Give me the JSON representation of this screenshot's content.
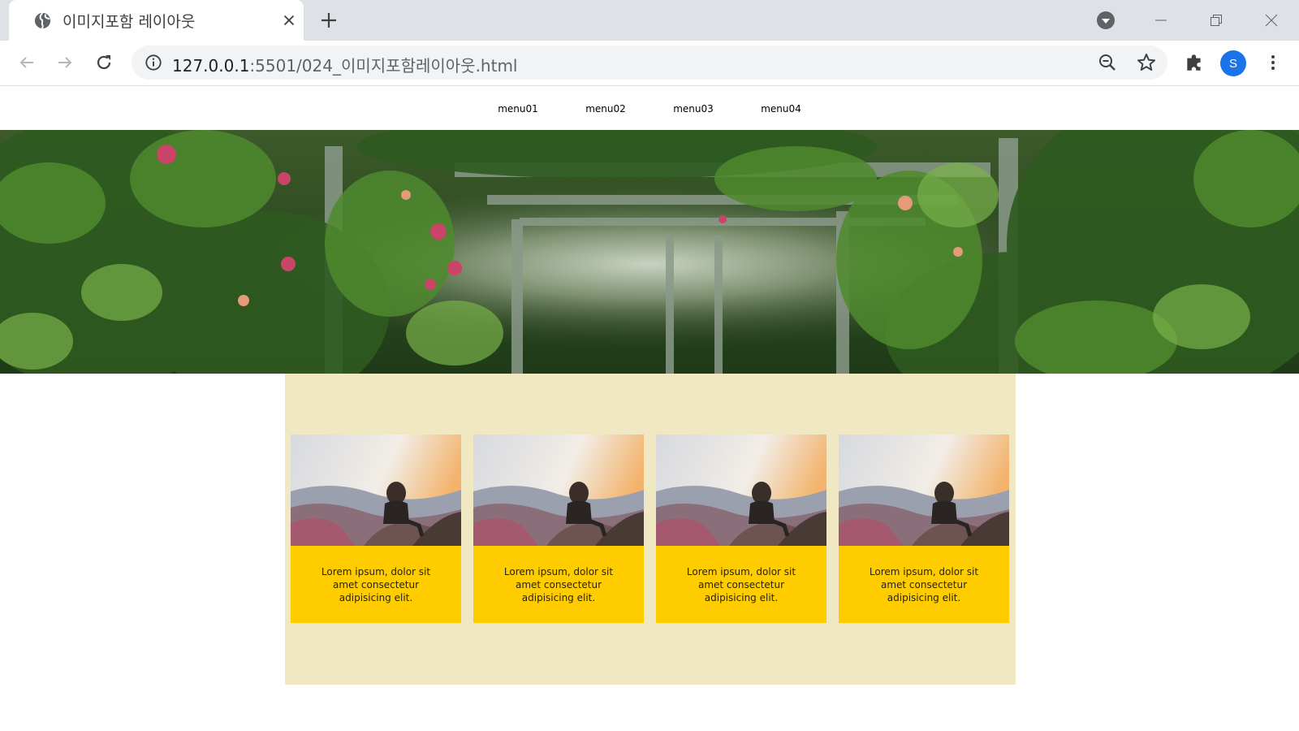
{
  "browser": {
    "tab_title": "이미지포함 레이아웃",
    "url_host": "127.0.0.1",
    "url_path": ":5501/024_이미지포함레이아웃.html",
    "avatar_letter": "S",
    "accent_color": "#1a73e8"
  },
  "icons": {
    "favicon": "globe-icon",
    "tab_close": "close-icon",
    "new_tab": "plus-icon",
    "profile_menu": "chevron-down-icon",
    "back": "arrow-left-icon",
    "forward": "arrow-right-icon",
    "reload": "reload-icon",
    "site_info": "info-icon",
    "zoom": "zoom-out-icon",
    "bookmark": "star-icon",
    "extensions": "puzzle-icon",
    "menu": "kebab-icon"
  },
  "page": {
    "menu": [
      "menu01",
      "menu02",
      "menu03",
      "menu04"
    ],
    "banner_image": "garden-pergola-photo",
    "content_bg": "#f0e8c2",
    "card_bg": "#ffcc00",
    "cards": [
      {
        "image": "woman-on-mountain-photo",
        "text": "Lorem ipsum, dolor sit amet consectetur adipisicing elit."
      },
      {
        "image": "woman-on-mountain-photo",
        "text": "Lorem ipsum, dolor sit amet consectetur adipisicing elit."
      },
      {
        "image": "woman-on-mountain-photo",
        "text": "Lorem ipsum, dolor sit amet consectetur adipisicing elit."
      },
      {
        "image": "woman-on-mountain-photo",
        "text": "Lorem ipsum, dolor sit amet consectetur adipisicing elit."
      }
    ]
  }
}
